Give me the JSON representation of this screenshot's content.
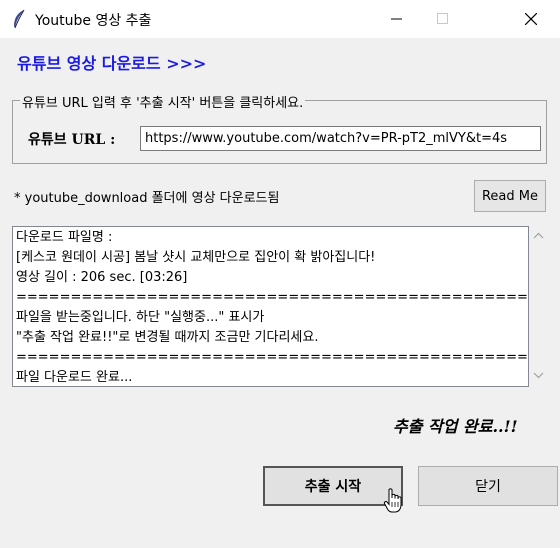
{
  "window": {
    "title": "Youtube 영상 추출"
  },
  "heading": "유튜브 영상 다운로드 >>>",
  "group": {
    "legend": "유튜브 URL 입력 후 '추출 시작' 버튼을 클릭하세요.",
    "url_label": "유튜브 URL :",
    "url_value": "https://www.youtube.com/watch?v=PR-pT2_mlVY&t=4s"
  },
  "note": "* youtube_download 폴더에 영상 다운로드됨",
  "readme_label": "Read Me",
  "log": [
    "다운로드 파일명 :",
    "[케스코 원데이 시공]  봄날 샷시 교체만으로 집안이 확 밝아집니다!",
    "영상 길이 : 206 sec. [03:26]",
    "================================================",
    "파일을 받는중입니다. 하단 \"실행중...\" 표시가",
    "\"추출 작업 완료!!\"로 변경될 때까지 조금만 기다리세요.",
    "================================================",
    "파일 다운로드 완료..."
  ],
  "status": "추출 작업 완료..!!",
  "buttons": {
    "start": "추출 시작",
    "close": "닫기"
  }
}
